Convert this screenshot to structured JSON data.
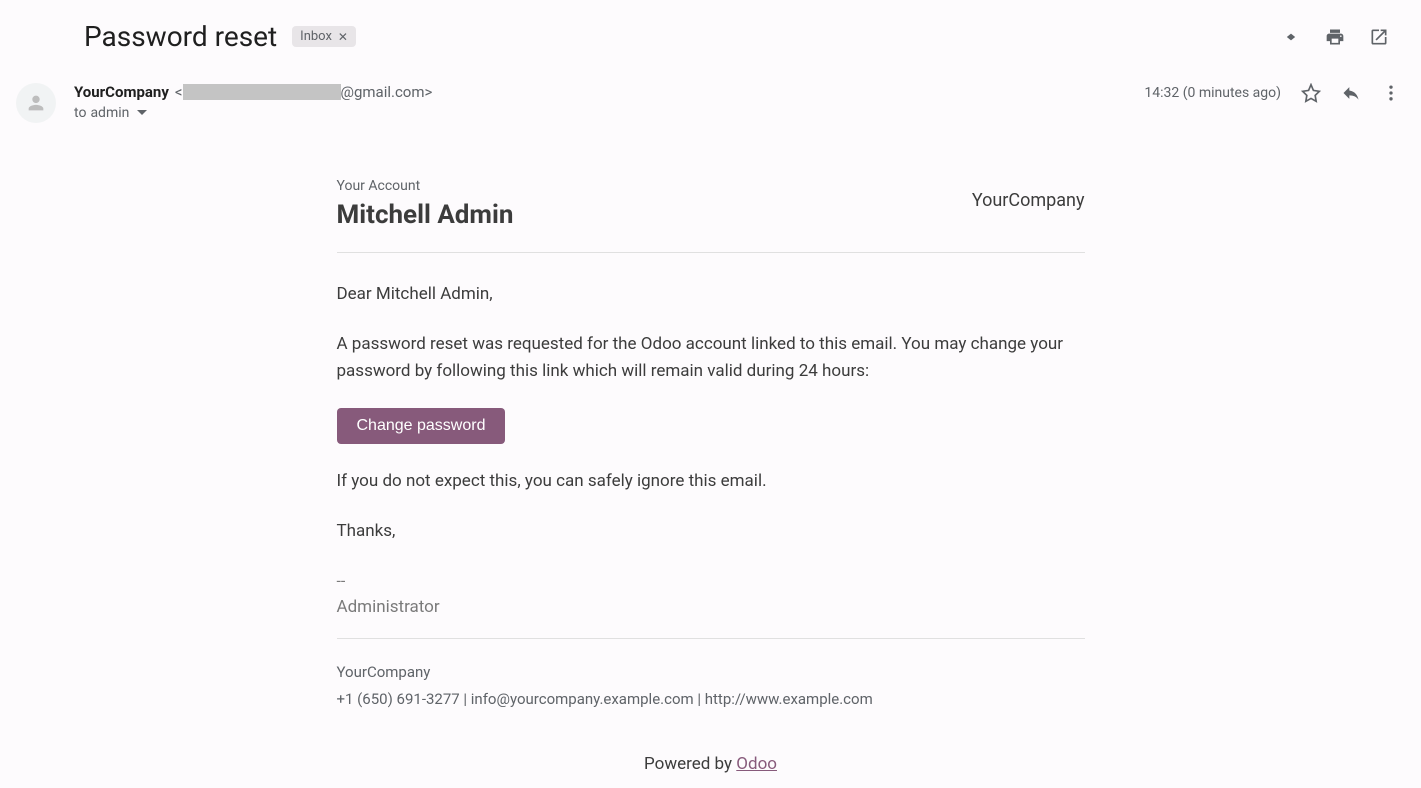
{
  "header": {
    "subject": "Password reset",
    "label": "Inbox"
  },
  "sender": {
    "name": "YourCompany",
    "email_suffix": "@gmail.com>",
    "email_prefix": "<",
    "recipient_prefix": "to ",
    "recipient": "admin",
    "timestamp": "14:32 (0 minutes ago)"
  },
  "body": {
    "your_account_label": "Your Account",
    "account_name": "Mitchell Admin",
    "company_brand": "YourCompany",
    "greeting": "Dear Mitchell Admin,",
    "paragraph1": "A password reset was requested for the Odoo account linked to this email. You may change your password by following this link which will remain valid during 24 hours:",
    "button_label": "Change password",
    "ignore_text": "If you do not expect this, you can safely ignore this email.",
    "thanks": "Thanks,",
    "signature_dash": "--",
    "signature_name": "Administrator"
  },
  "footer": {
    "company": "YourCompany",
    "contact": "+1 (650) 691-3277 | info@yourcompany.example.com | http://www.example.com",
    "powered_prefix": "Powered by ",
    "powered_link": "Odoo"
  }
}
